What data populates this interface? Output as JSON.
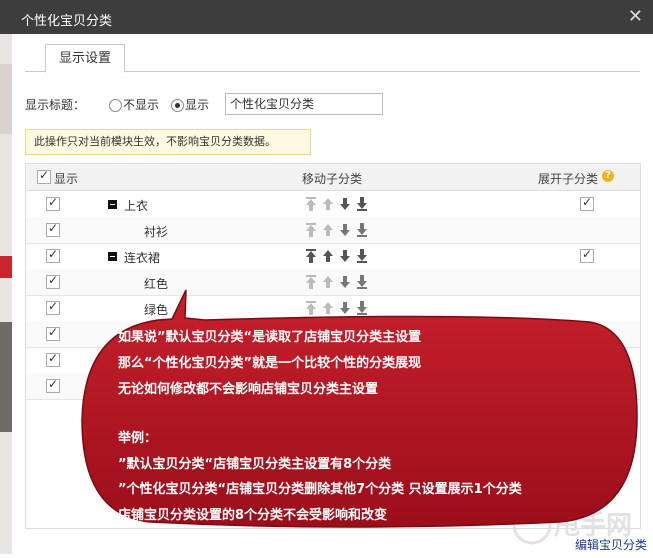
{
  "dialog": {
    "title": "个性化宝贝分类",
    "close_icon": "close-icon"
  },
  "tabs": [
    {
      "label": "显示设置"
    }
  ],
  "display_title": {
    "label": "显示标题：",
    "option_hide": "不显示",
    "option_show": "显示",
    "selected": "显示",
    "input_value": "个性化宝贝分类"
  },
  "notice": "此操作只对当前模块生效，不影响宝贝分类数据。",
  "table": {
    "col_show": "显示",
    "col_move": "移动子分类",
    "col_expand": "展开子分类",
    "rows": [
      {
        "name": "上衣",
        "level": 0,
        "show": true,
        "expand": true
      },
      {
        "name": "衬衫",
        "level": 1,
        "show": true,
        "expand": false
      },
      {
        "name": "连衣裙",
        "level": 0,
        "show": true,
        "expand": true
      },
      {
        "name": "红色",
        "level": 1,
        "show": true,
        "expand": false
      },
      {
        "name": "绿色",
        "level": 1,
        "show": true,
        "expand": false
      },
      {
        "name": "",
        "level": 1,
        "show": true,
        "expand": false
      },
      {
        "name": "",
        "level": 1,
        "show": true,
        "expand": false
      },
      {
        "name": "",
        "level": 1,
        "show": true,
        "expand": false
      }
    ]
  },
  "annotation": {
    "lines": [
      "如果说”默认宝贝分类“是读取了店铺宝贝分类主设置",
      "那么“个性化宝贝分类”就是一个比较个性的分类展现",
      "无论如何修改都不会影响店铺宝贝分类主设置",
      "",
      "举例：",
      "”默认宝贝分类“店铺宝贝分类主设置有8个分类",
      "”个性化宝贝分类“店铺宝贝分类删除其他7个分类 只设置展示1个分类",
      "店铺宝贝分类设置的8个分类不会受影响和改变"
    ],
    "fill": "#b1121f"
  },
  "footer_link": "编辑宝贝分类",
  "watermark": "甩手网"
}
